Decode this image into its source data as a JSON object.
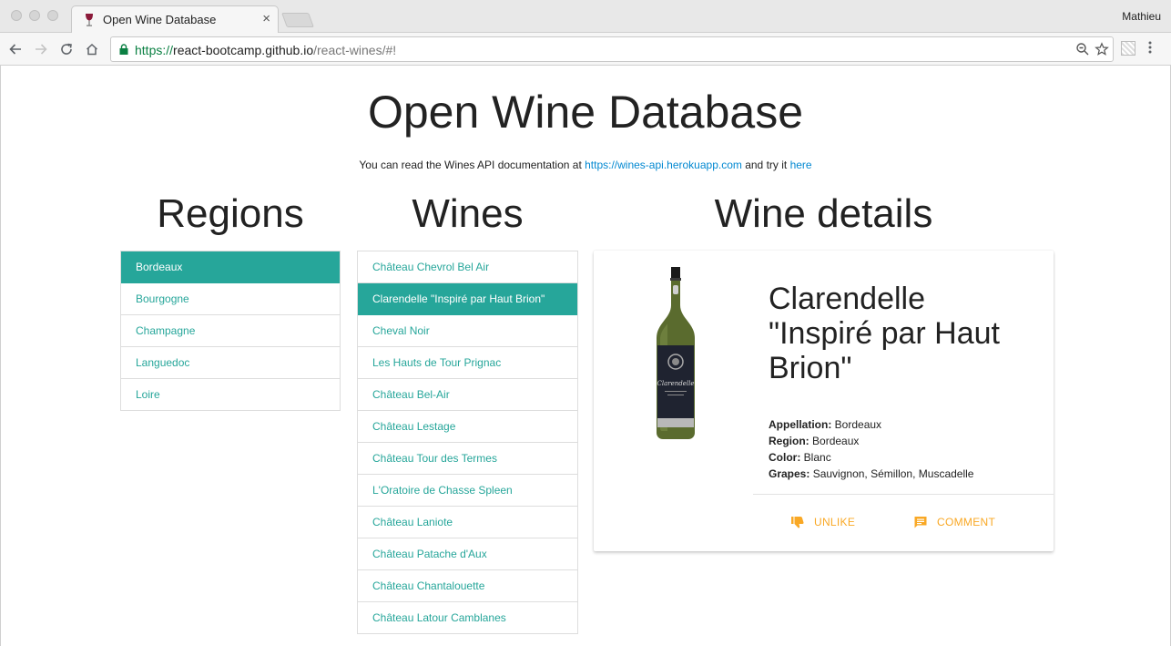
{
  "browser": {
    "tab_title": "Open Wine Database",
    "tab_close": "×",
    "profile_name": "Mathieu",
    "url": {
      "scheme": "https://",
      "host": "react-bootcamp.github.io",
      "path": "/react-wines/#!"
    },
    "icons": [
      "back-icon",
      "forward-icon",
      "reload-icon",
      "home-icon",
      "lock-icon",
      "zoom-icon",
      "star-icon",
      "extension-icon",
      "menu-icon"
    ]
  },
  "page": {
    "title": "Open Wine Database",
    "intro": {
      "prefix": "You can read the Wines API documentation at ",
      "api_link": "https://wines-api.herokuapp.com",
      "middle": " and try it ",
      "try_link": "here"
    }
  },
  "regions": {
    "title": "Regions",
    "selected": "Bordeaux",
    "items": [
      "Bordeaux",
      "Bourgogne",
      "Champagne",
      "Languedoc",
      "Loire"
    ]
  },
  "wines": {
    "title": "Wines",
    "selected": "Clarendelle \"Inspiré par Haut Brion\"",
    "items": [
      "Château Chevrol Bel Air",
      "Clarendelle \"Inspiré par Haut Brion\"",
      "Cheval Noir",
      "Les Hauts de Tour Prignac",
      "Château Bel-Air",
      "Château Lestage",
      "Château Tour des Termes",
      "L'Oratoire de Chasse Spleen",
      "Château Laniote",
      "Château Patache d'Aux",
      "Château Chantalouette",
      "Château Latour Camblanes"
    ]
  },
  "details": {
    "title": "Wine details",
    "name": "Clarendelle \"Inspiré par Haut Brion\"",
    "fields": [
      {
        "label": "Appellation:",
        "value": "Bordeaux"
      },
      {
        "label": "Region:",
        "value": "Bordeaux"
      },
      {
        "label": "Color:",
        "value": "Blanc"
      },
      {
        "label": "Grapes:",
        "value": "Sauvignon, Sémillon, Muscadelle"
      }
    ],
    "bottle_label": "Clarendelle",
    "actions": {
      "unlike": "UNLIKE",
      "comment": "COMMENT"
    }
  },
  "colors": {
    "accent": "#26a69a",
    "action": "#f9a825",
    "link": "#0288d1"
  }
}
